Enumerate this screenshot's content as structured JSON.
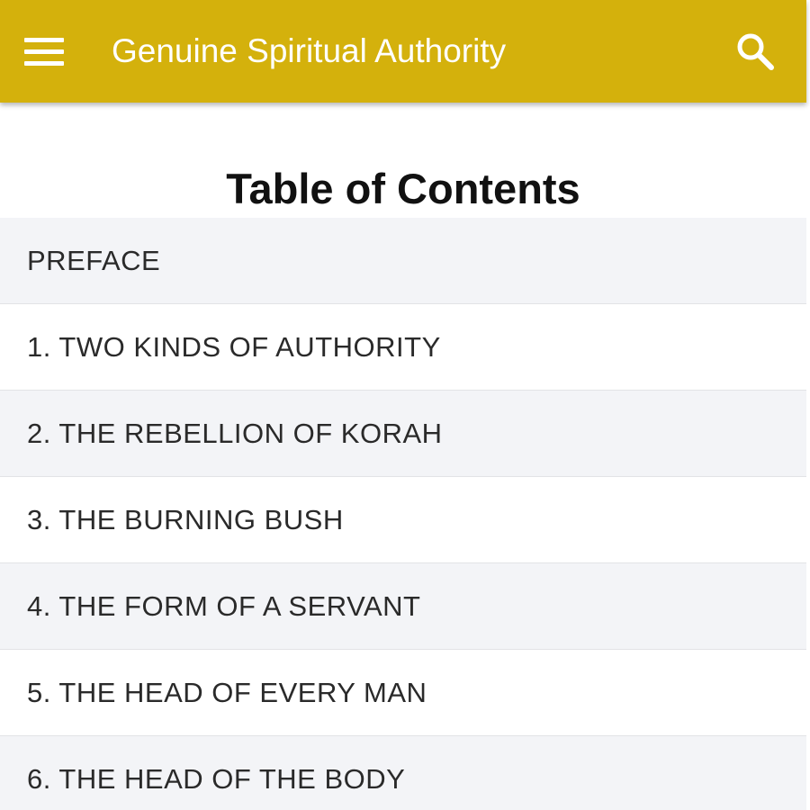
{
  "appbar": {
    "title": "Genuine Spiritual Authority",
    "background_color": "#d4b10c",
    "menu_icon": "hamburger-menu-icon",
    "search_icon": "magnifier-search-icon"
  },
  "content": {
    "heading": "Table of Contents",
    "items": [
      {
        "label": "PREFACE"
      },
      {
        "label": "1. TWO KINDS OF AUTHORITY"
      },
      {
        "label": "2. THE REBELLION OF KORAH"
      },
      {
        "label": "3. THE BURNING BUSH"
      },
      {
        "label": "4. THE FORM OF A SERVANT"
      },
      {
        "label": "5. THE HEAD OF EVERY MAN"
      },
      {
        "label": "6. THE HEAD OF THE BODY"
      }
    ]
  }
}
